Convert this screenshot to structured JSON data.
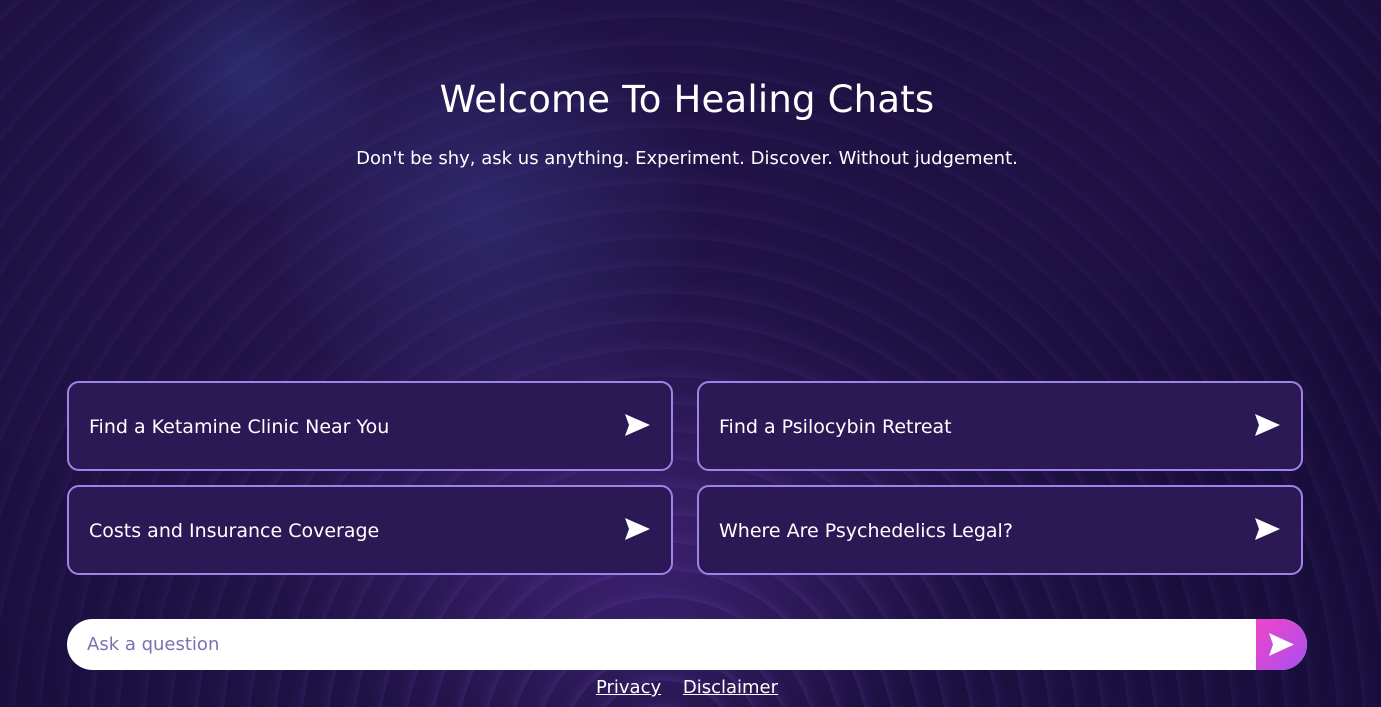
{
  "header": {
    "title": "Welcome To Healing Chats",
    "subtitle": "Don't be shy, ask us anything. Experiment. Discover. Without judgement."
  },
  "suggestions": [
    {
      "label": "Find a Ketamine Clinic Near You",
      "icon": "send-arrow-icon"
    },
    {
      "label": "Find a Psilocybin Retreat",
      "icon": "send-arrow-icon"
    },
    {
      "label": "Costs and Insurance Coverage",
      "icon": "send-arrow-icon"
    },
    {
      "label": "Where Are Psychedelics Legal?",
      "icon": "send-arrow-icon"
    }
  ],
  "ask": {
    "placeholder": "Ask a question",
    "value": "",
    "send_icon": "send-arrow-icon"
  },
  "footer": {
    "links": [
      "Privacy",
      "Disclaimer"
    ]
  },
  "colors": {
    "background": "#2a1a55",
    "card_background": "#2b1956",
    "card_border": "#9f83e6",
    "send_gradient_start": "#f045c8",
    "send_gradient_end": "#a94ef0",
    "placeholder": "#7f6fb0"
  }
}
